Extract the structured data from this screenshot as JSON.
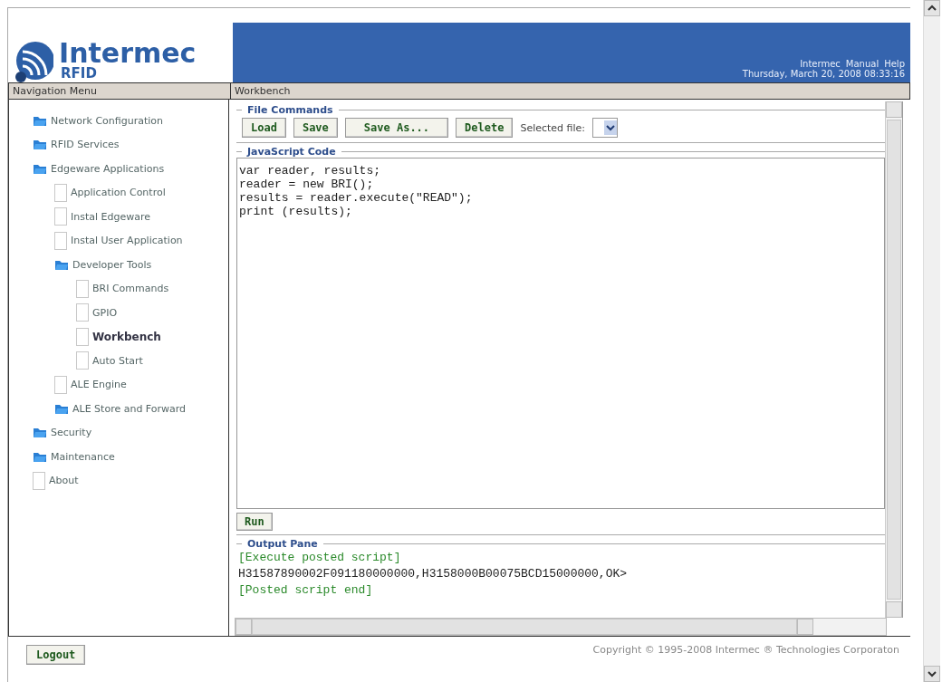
{
  "header": {
    "logo_name": "Intermec",
    "logo_sub": "RFID",
    "links": [
      "Intermec",
      "Manual",
      "Help"
    ],
    "datetime": "Thursday, March 20, 2008 08:33:16"
  },
  "nav": {
    "title": "Navigation Menu",
    "items": [
      {
        "label": "Network Configuration",
        "kind": "folder",
        "selected": false
      },
      {
        "label": "RFID Services",
        "kind": "folder",
        "selected": false
      },
      {
        "label": "Edgeware Applications",
        "kind": "folder",
        "selected": false,
        "children": [
          {
            "label": "Application Control",
            "kind": "page",
            "selected": false
          },
          {
            "label": "Instal Edgeware",
            "kind": "page",
            "selected": false
          },
          {
            "label": "Instal User Application",
            "kind": "page",
            "selected": false
          },
          {
            "label": "Developer Tools",
            "kind": "folder",
            "selected": false,
            "children": [
              {
                "label": "BRI Commands",
                "kind": "page",
                "selected": false
              },
              {
                "label": "GPIO",
                "kind": "page",
                "selected": false
              },
              {
                "label": "Workbench",
                "kind": "page",
                "selected": true
              },
              {
                "label": "Auto Start",
                "kind": "page",
                "selected": false
              }
            ]
          },
          {
            "label": "ALE Engine",
            "kind": "page",
            "selected": false
          },
          {
            "label": "ALE Store and Forward",
            "kind": "folder",
            "selected": false
          }
        ]
      },
      {
        "label": "Security",
        "kind": "folder",
        "selected": false
      },
      {
        "label": "Maintenance",
        "kind": "folder",
        "selected": false
      },
      {
        "label": "About",
        "kind": "page",
        "selected": false
      }
    ]
  },
  "workbench": {
    "title": "Workbench",
    "file_commands": {
      "legend": "File Commands",
      "buttons": [
        "Load",
        "Save",
        "Save As...",
        "Delete"
      ],
      "selected_file_label": "Selected file:"
    },
    "code": {
      "legend": "JavaScript Code",
      "lines": [
        "var reader, results;",
        "reader = new BRI();",
        "results = reader.execute(\"READ\");",
        "print (results);"
      ]
    },
    "run_button": "Run",
    "output": {
      "legend": "Output Pane",
      "lines": [
        {
          "text": "[Execute posted script]",
          "kind": "status"
        },
        {
          "text": "H31587890002F091180000000,H3158000B00075BCD15000000,OK>",
          "kind": "data"
        },
        {
          "text": "[Posted script end]",
          "kind": "status"
        }
      ]
    }
  },
  "logout_button": "Logout",
  "copyright": "Copyright © 1995-2008 Intermec ® Technologies Corporaton"
}
